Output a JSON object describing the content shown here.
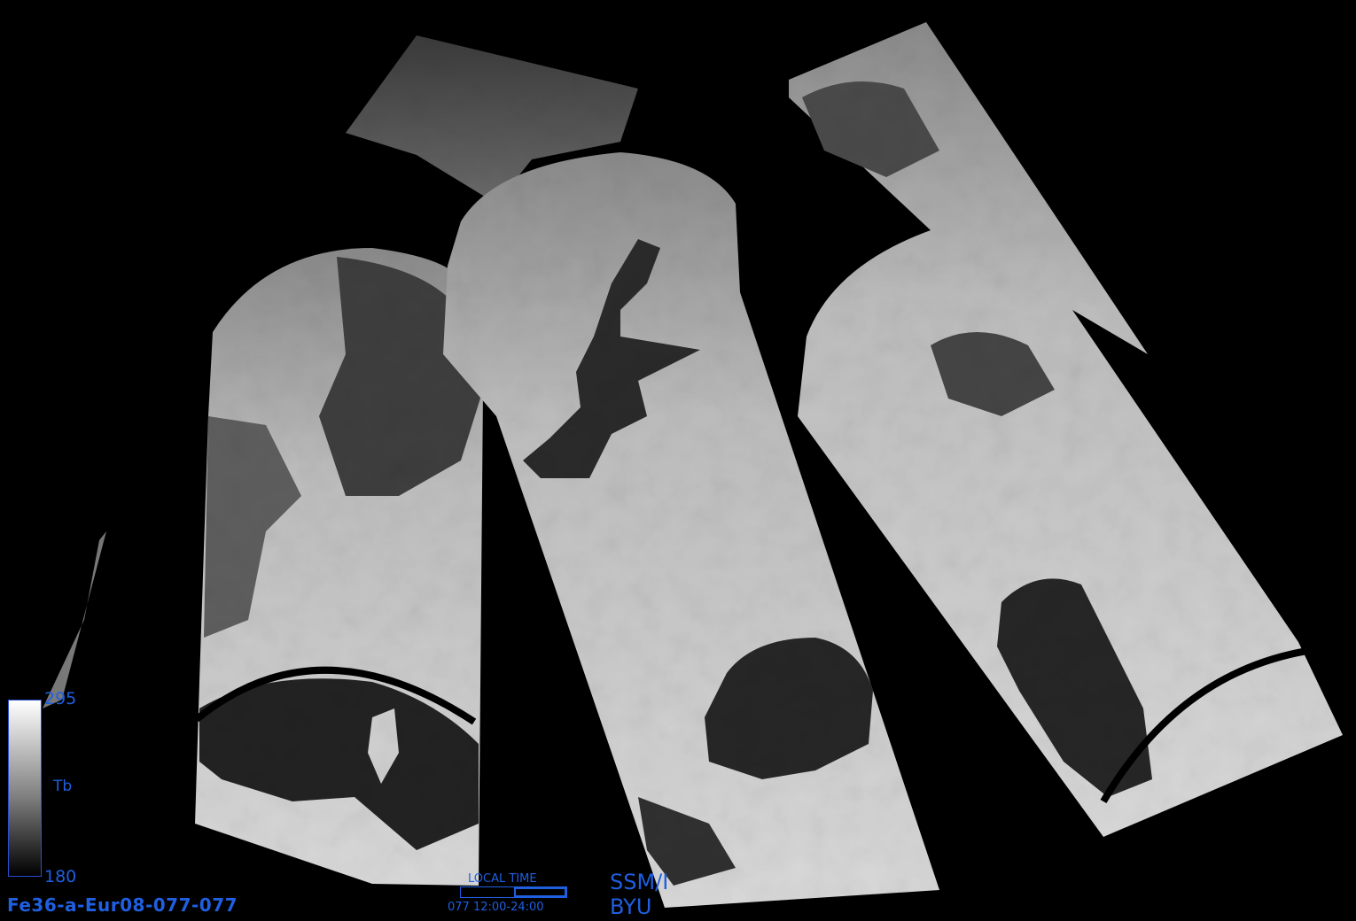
{
  "colorbar": {
    "max_label": "295",
    "min_label": "180",
    "variable_label": "Tb",
    "colors": [
      "#ffffff",
      "#000000"
    ],
    "frame_color": "#2b4fd0"
  },
  "footer": {
    "product_id": "Fe36-a-Eur08-077-077",
    "local_time_title": "LOCAL TIME",
    "local_time_range": "077  12:00-24:00",
    "local_time_fraction_start": 0.5,
    "sensor": "SSM/I",
    "institution": "BYU",
    "label_color": "#1f5fe0"
  },
  "image": {
    "description_type": "grayscale brightness temperature swath mosaic",
    "background": "#000000"
  }
}
